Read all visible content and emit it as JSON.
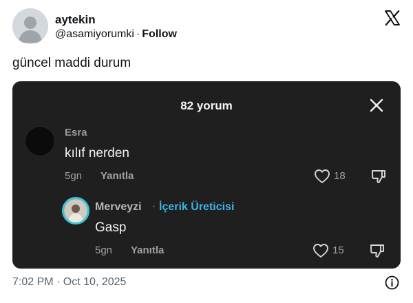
{
  "author": {
    "name": "aytekin",
    "handle": "@asamiyorumki",
    "separator": "·",
    "follow_label": "Follow"
  },
  "tweet": {
    "text": "güncel maddi durum",
    "timestamp": "7:02 PM · Oct 10, 2025"
  },
  "icons": {
    "brand": "x-logo-icon",
    "info": "info-icon",
    "close": "close-icon",
    "like": "heart-icon",
    "dislike": "thumbs-down-icon"
  },
  "comments_panel": {
    "title": "82 yorum",
    "comments": [
      {
        "user": "Esra",
        "text": "kılıf nerden",
        "age": "5gn",
        "reply_label": "Yanıtla",
        "likes": "18"
      },
      {
        "user": "Merveyzi",
        "separator": "·",
        "badge": "İçerik Üreticisi",
        "text": "Gasp",
        "age": "5gn",
        "reply_label": "Yanıtla",
        "likes": "15"
      }
    ]
  },
  "colors": {
    "panel_bg": "#1f1f1f",
    "creator_badge": "#3bb4e6",
    "avatar_ring": "#37c6d6",
    "muted_text": "#536471"
  }
}
